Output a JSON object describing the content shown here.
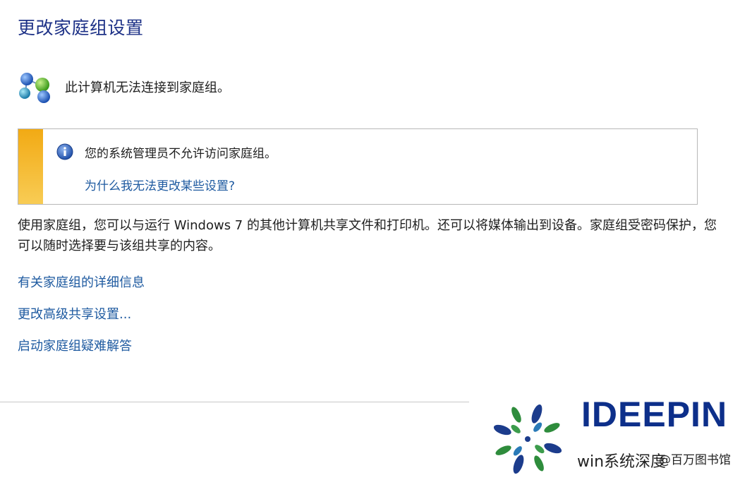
{
  "page": {
    "title": "更改家庭组设置"
  },
  "status": {
    "message": "此计算机无法连接到家庭组。",
    "icon": "homegroup-icon"
  },
  "notice": {
    "accent_color": "#f2aa14",
    "icon": "info-icon",
    "message": "您的系统管理员不允许访问家庭组。",
    "link": "为什么我无法更改某些设置?"
  },
  "description": "使用家庭组，您可以与运行 Windows 7 的其他计算机共享文件和打印机。还可以将媒体输出到设备。家庭组受密码保护，您可以随时选择要与该组共享的内容。",
  "links": [
    {
      "label": "有关家庭组的详细信息"
    },
    {
      "label": "更改高级共享设置..."
    },
    {
      "label": "启动家庭组疑难解答"
    }
  ],
  "watermark": {
    "brand": "IDEEPIN",
    "caption": "win系统深度",
    "caption_small": "@百万图书馆"
  }
}
